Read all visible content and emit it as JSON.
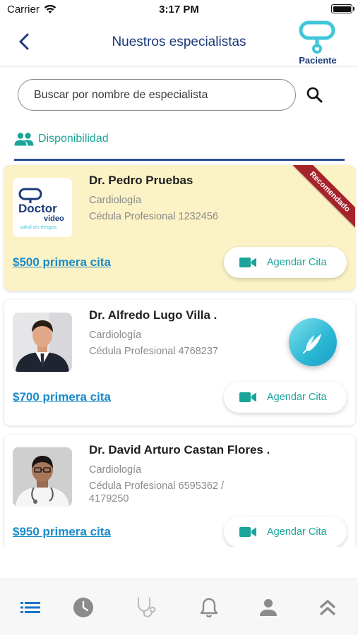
{
  "status_bar": {
    "carrier": "Carrier",
    "time": "3:17 PM"
  },
  "header": {
    "title": "Nuestros especialistas",
    "brand_label": "Paciente"
  },
  "search": {
    "placeholder": "Buscar por nombre de especialista"
  },
  "tabs": [
    {
      "label": "Disponibilidad",
      "icon": "people-icon"
    }
  ],
  "doctors": [
    {
      "name": "Dr. Pedro Pruebas",
      "specialty": "Cardiología",
      "license": "Cédula Profesional 1232456",
      "price": "$500 primera cita",
      "button": "Agendar Cita",
      "ribbon": "Recomendado",
      "logo_word": "Doctor",
      "logo_word2": "video",
      "logo_tagline": "salud sin riesgos"
    },
    {
      "name": "Dr. Alfredo Lugo Villa .",
      "specialty": "Cardiología",
      "license": "Cédula Profesional 4768237",
      "price": "$700 primera cita",
      "button": "Agendar Cita"
    },
    {
      "name": "Dr. David Arturo Castan Flores .",
      "specialty": "Cardiología",
      "license": "Cédula Profesional 6595362 / 4179250",
      "price": "$950 primera cita",
      "button": "Agendar Cita"
    }
  ],
  "bottom_nav": [
    {
      "icon": "list-icon",
      "active": true
    },
    {
      "icon": "clock-icon"
    },
    {
      "icon": "stethoscope-icon"
    },
    {
      "icon": "bell-icon"
    },
    {
      "icon": "user-icon"
    },
    {
      "icon": "double-chevron-up-icon"
    }
  ],
  "colors": {
    "primary": "#1b3a7a",
    "accent": "#1aa59a",
    "link": "#1a8bc9",
    "recommended_bg": "#fbf2c5",
    "ribbon": "#a6232c"
  }
}
